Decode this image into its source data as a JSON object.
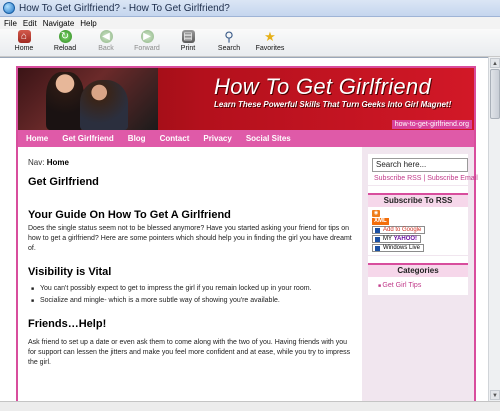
{
  "window": {
    "title": "How To Get Girlfriend? - How To Get Girlfriend?"
  },
  "menu": [
    "File",
    "Edit",
    "Navigate",
    "Help"
  ],
  "toolbar": {
    "home": "Home",
    "reload": "Reload",
    "back": "Back",
    "forward": "Forward",
    "print": "Print",
    "search": "Search",
    "favorites": "Favorites"
  },
  "site": {
    "banner_title": "How To Get Girlfriend",
    "banner_tagline": "Learn These Powerful Skills That Turn Geeks Into Girl Magnet!",
    "banner_url": "how-to-get-girlfriend.org",
    "nav": [
      "Home",
      "Get Girlfriend",
      "Blog",
      "Contact",
      "Privacy",
      "Social Sites"
    ]
  },
  "content": {
    "breadcrumb_prefix": "Nav:",
    "breadcrumb_current": "Home",
    "page_title": "Get Girlfriend",
    "guide_heading": "Your Guide On How To Get A Girlfriend",
    "guide_paragraph": "Does the single status seem not to be blessed anymore? Have you started asking your friend for tips on how to get a girlfriend?  Here are some pointers which should help you in finding the girl you have dreamt of.",
    "visibility_heading": "Visibility is Vital",
    "visibility_bullets": [
      "You can't possibly expect to get to impress the girl if you remain locked up in your room.",
      "Socialize and mingle- which is a more subtle way of showing you're available."
    ],
    "friends_heading": "Friends…Help!",
    "friends_paragraph": "Ask friend to set up a date or even ask them to come along with the two of you. Having friends with you for support can lessen the jitters and make you feel more confident and at ease, while you try to impress the girl."
  },
  "sidebar": {
    "search_placeholder": "Search here...",
    "subscribe_rss_link": "Subscribe RSS",
    "separator": "|",
    "subscribe_email_link": "Subscribe Email",
    "subscribe_heading": "Subscribe To RSS",
    "xml_label": "XML",
    "google_button": "Add to Google",
    "yahoo_button_prefix": "MY",
    "yahoo_button_brand": "YAHOO!",
    "windows_live_button": "Windows Live",
    "categories_heading": "Categories",
    "categories": [
      "Get Girl Tips"
    ]
  },
  "colors": {
    "accent_pink": "#d84d9d",
    "nav_pink": "#df5aa8",
    "sidebar_bg": "#f1e6ef"
  }
}
